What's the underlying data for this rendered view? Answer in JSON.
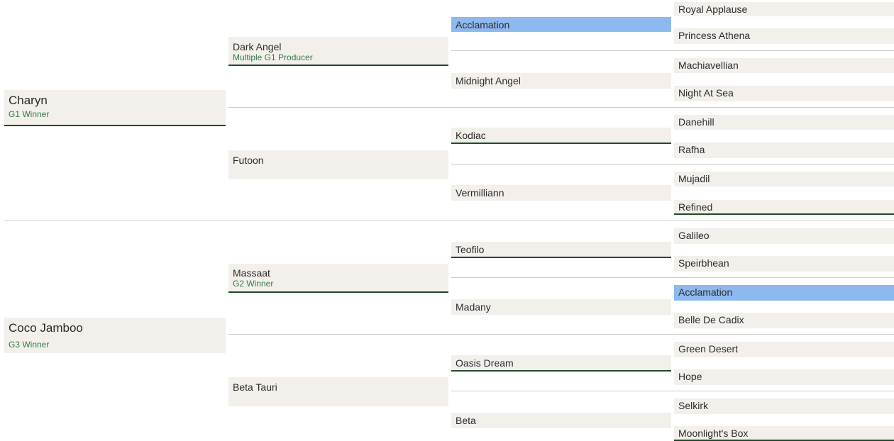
{
  "pedigree": {
    "sire": {
      "name": "Charyn",
      "note": "G1 Winner",
      "sire": {
        "name": "Dark Angel",
        "note": "Multiple G1 Producer",
        "sire": {
          "name": "Acclamation",
          "sire": "Royal Applause",
          "dam": "Princess Athena"
        },
        "dam": {
          "name": "Midnight Angel",
          "sire": "Machiavellian",
          "dam": "Night At Sea"
        }
      },
      "dam": {
        "name": "Futoon",
        "sire": {
          "name": "Kodiac",
          "sire": "Danehill",
          "dam": "Rafha"
        },
        "dam": {
          "name": "Vermilliann",
          "sire": "Mujadil",
          "dam": "Refined"
        }
      }
    },
    "dam": {
      "name": "Coco Jamboo",
      "note": "G3 Winner",
      "sire": {
        "name": "Massaat",
        "note": "G2 Winner",
        "sire": {
          "name": "Teofilo",
          "sire": "Galileo",
          "dam": "Speirbhean"
        },
        "dam": {
          "name": "Madany",
          "sire": "Acclamation",
          "dam": "Belle De Cadix"
        }
      },
      "dam": {
        "name": "Beta Tauri",
        "sire": {
          "name": "Oasis Dream",
          "sire": "Green Desert",
          "dam": "Hope"
        },
        "dam": {
          "name": "Beta",
          "sire": "Selkirk",
          "dam": "Moonlight's Box"
        }
      }
    }
  },
  "colors": {
    "cell_bg": "#f3f0ec",
    "highlight": "#8db9ef",
    "underline": "#1f4a2a",
    "note_text": "#2f7a44"
  }
}
